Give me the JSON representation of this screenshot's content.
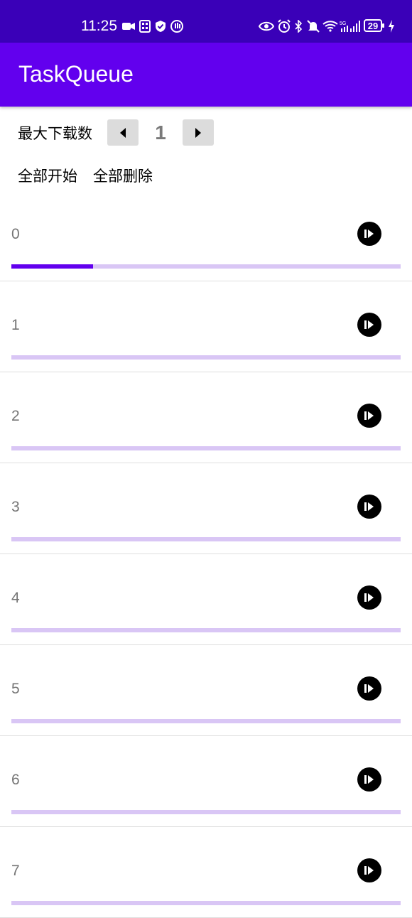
{
  "status_bar": {
    "time": "11:25",
    "battery": "29",
    "left_icons": [
      "video-icon",
      "qr-icon",
      "shield-icon",
      "hand-icon"
    ],
    "right_icons": [
      "eye-icon",
      "alarm-icon",
      "bluetooth-icon",
      "bell-off-icon",
      "wifi-icon",
      "5g-signal-icon",
      "signal-icon",
      "charging-icon"
    ]
  },
  "app_bar": {
    "title": "TaskQueue"
  },
  "controls": {
    "max_downloads_label": "最大下载数",
    "max_downloads_value": "1",
    "start_all_label": "全部开始",
    "delete_all_label": "全部删除"
  },
  "tasks": [
    {
      "label": "0",
      "progress": 0.21
    },
    {
      "label": "1",
      "progress": 0
    },
    {
      "label": "2",
      "progress": 0
    },
    {
      "label": "3",
      "progress": 0
    },
    {
      "label": "4",
      "progress": 0
    },
    {
      "label": "5",
      "progress": 0
    },
    {
      "label": "6",
      "progress": 0
    },
    {
      "label": "7",
      "progress": 0
    }
  ],
  "colors": {
    "status_bar": "#3a00b8",
    "primary": "#6200ee",
    "progress_track": "#d9c6f5"
  }
}
